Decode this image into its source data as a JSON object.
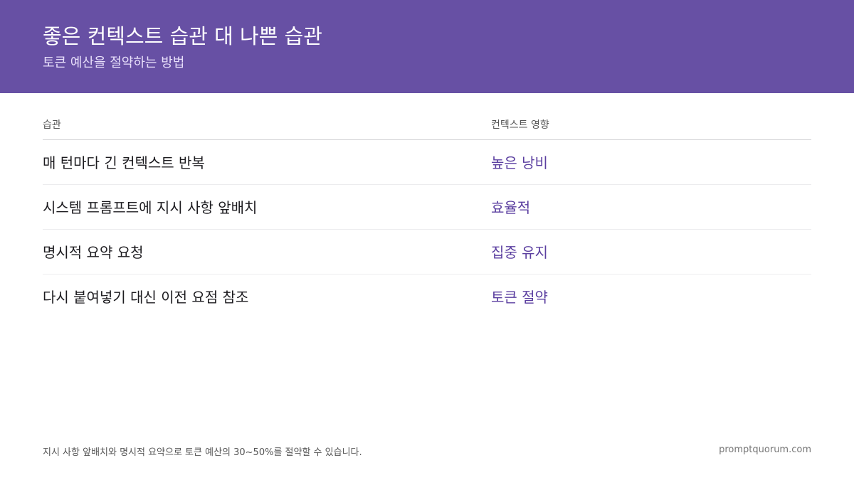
{
  "header": {
    "title": "좋은 컨텍스트 습관 대 나쁜 습관",
    "subtitle": "토큰 예산을 절약하는 방법"
  },
  "table": {
    "columns": [
      "습관",
      "컨텍스트 영향"
    ],
    "rows": [
      {
        "habit": "매 턴마다 긴 컨텍스트 반복",
        "impact": "높은 낭비"
      },
      {
        "habit": "시스템 프롬프트에 지시 사항 앞배치",
        "impact": "효율적"
      },
      {
        "habit": "명시적 요약 요청",
        "impact": "집중 유지"
      },
      {
        "habit": "다시 붙여넣기 대신 이전 요점 참조",
        "impact": "토큰 절약"
      }
    ]
  },
  "footer": {
    "note": "지시 사항 앞배치와 명시적 요약으로 토큰 예산의 30~50%를 절약할 수 있습니다.",
    "site": "promptquorum.com"
  },
  "colors": {
    "header_bg": "#6750a4",
    "impact_text": "#5b3fa0"
  }
}
